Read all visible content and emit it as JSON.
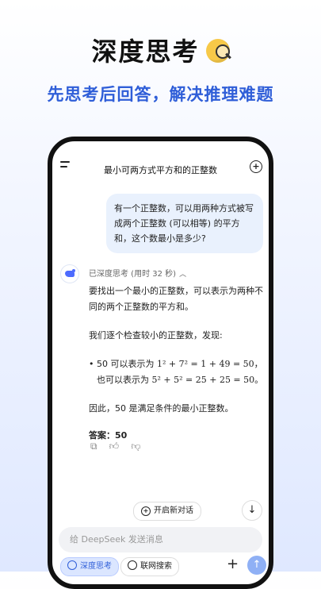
{
  "headline": "深度思考",
  "subline": "先思考后回答，解决推理难题",
  "chat": {
    "title": "最小可两方式平方和的正整数",
    "user_message": "有一个正整数，可以用两种方式被写成两个正整数 (可以相等) 的平方和，这个数最小是多少?",
    "thinking_label": "已深度思考 (用时 32 秒)",
    "answer": {
      "p1": "要找出一个最小的正整数，可以表示为两种不同的两个正整数的平方和。",
      "p2": "我们逐个检查较小的正整数，发现:",
      "bullet_prefix": "50 可以表示为 ",
      "bullet_math1": "1² + 7² = 1 + 49 = 50",
      "bullet_mid": "，也可以表示为 ",
      "bullet_math2": "5² + 5² = 25 + 25 = 50",
      "bullet_suffix": "。",
      "p3": "因此，50 是满足条件的最小正整数。",
      "final": "答案：50"
    },
    "new_chat_label": "开启新对话",
    "input_placeholder": "给 DeepSeek 发送消息",
    "chip_deep": "深度思考",
    "chip_web": "联网搜索"
  },
  "icons": [
    "menu-icon",
    "new-chat-icon",
    "copy-icon",
    "thumbs-up-icon",
    "thumbs-down-icon",
    "arrow-down-icon",
    "plus-icon",
    "send-icon",
    "globe-icon",
    "atom-icon"
  ],
  "colors": {
    "accent": "#2f5ed8",
    "bubble": "#e9f1fd"
  }
}
